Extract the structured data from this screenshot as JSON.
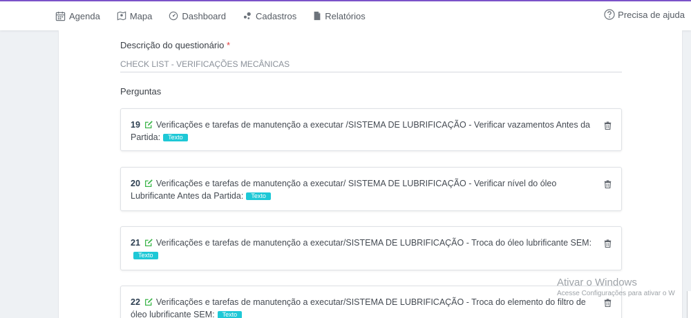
{
  "nav": {
    "items": [
      {
        "label": "Agenda",
        "icon": "calendar-icon"
      },
      {
        "label": "Mapa",
        "icon": "map-icon"
      },
      {
        "label": "Dashboard",
        "icon": "dashboard-icon"
      },
      {
        "label": "Cadastros",
        "icon": "cluster-icon"
      },
      {
        "label": "Relatórios",
        "icon": "file-icon"
      }
    ],
    "help_label": "Precisa de ajuda"
  },
  "form": {
    "description_label": "Descrição do questionário",
    "required_mark": "*",
    "description_value": "CHECK LIST - VERIFICAÇÕES MECÂNICAS",
    "questions_label": "Perguntas"
  },
  "questions": [
    {
      "number": "19",
      "text": "Verificações e tarefas de manutenção a executar /SISTEMA DE LUBRIFICAÇÃO - Verificar vazamentos Antes da Partida:",
      "type": "Texto"
    },
    {
      "number": "20",
      "text": "Verificações e tarefas de manutenção a executar/ SISTEMA DE LUBRIFICAÇÃO - Verificar nível do óleo Lubrificante Antes da Partida:",
      "type": "Texto"
    },
    {
      "number": "21",
      "text": "Verificações e tarefas de manutenção a executar/SISTEMA DE LUBRIFICAÇÃO - Troca do óleo lubrificante SEM:",
      "type": "Texto"
    },
    {
      "number": "22",
      "text": "Verificações e tarefas de manutenção a executar/SISTEMA DE LUBRIFICAÇÃO - Troca do elemento do filtro de óleo lubrificante SEM:",
      "type": "Texto"
    }
  ],
  "watermark": {
    "title": "Ativar o Windows",
    "subtitle": "Acesse Configurações para ativar o W"
  },
  "colors": {
    "accent": "#7b52c9",
    "badge": "#1ec8d6",
    "edit_icon": "#3cb54a"
  }
}
